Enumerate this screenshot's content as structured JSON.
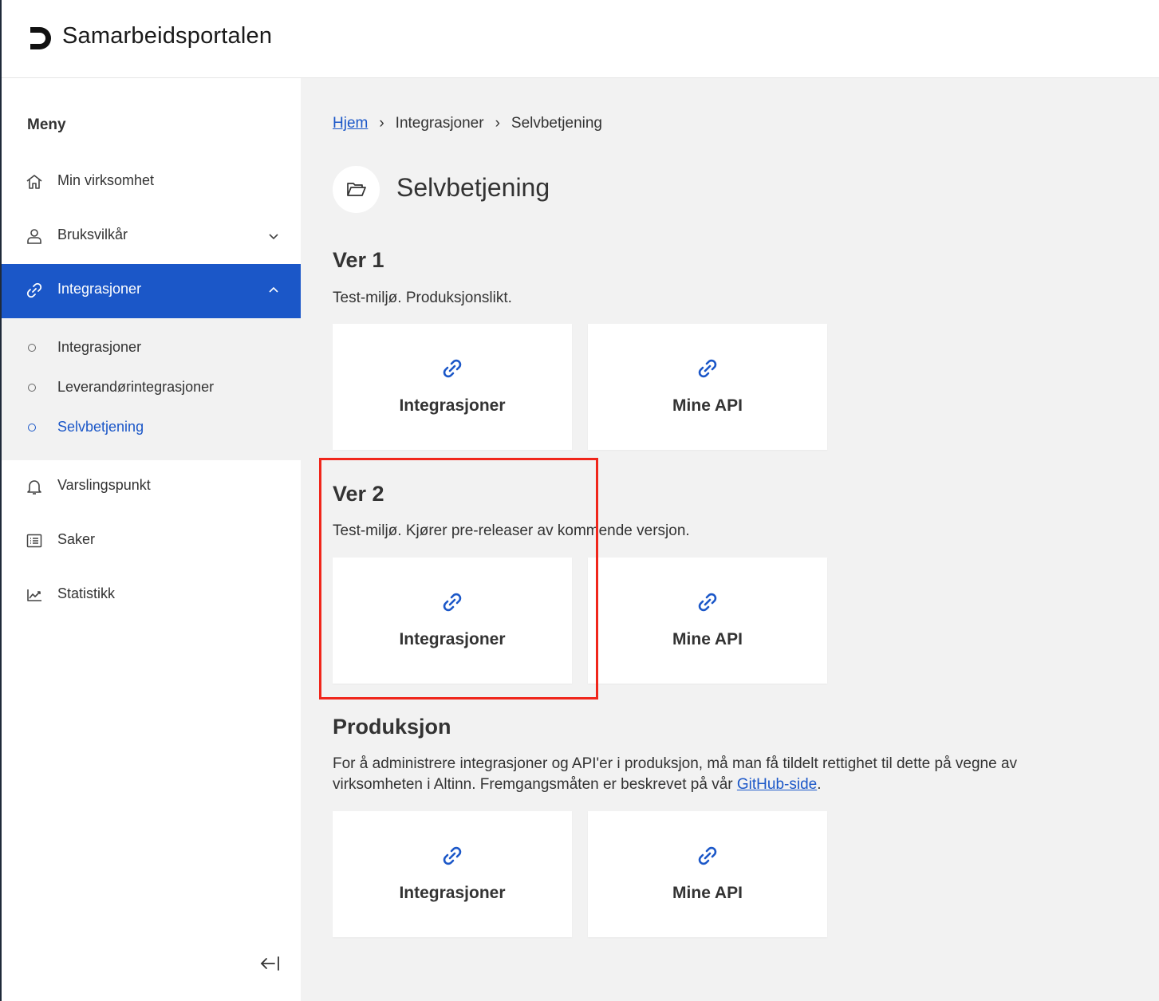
{
  "header": {
    "app_title": "Samarbeidsportalen"
  },
  "sidebar": {
    "menu_title": "Meny",
    "items": [
      {
        "label": "Min virksomhet",
        "icon": "home-icon"
      },
      {
        "label": "Bruksvilkår",
        "icon": "user-icon"
      },
      {
        "label": "Integrasjoner",
        "icon": "link-icon",
        "active": true
      },
      {
        "label": "Varslingspunkt",
        "icon": "bell-icon"
      },
      {
        "label": "Saker",
        "icon": "list-icon"
      },
      {
        "label": "Statistikk",
        "icon": "chart-icon"
      }
    ],
    "subitems": [
      {
        "label": "Integrasjoner"
      },
      {
        "label": "Leverandørintegrasjoner"
      },
      {
        "label": "Selvbetjening",
        "current": true
      }
    ]
  },
  "breadcrumb": {
    "home": "Hjem",
    "level1": "Integrasjoner",
    "current": "Selvbetjening",
    "separator": "›"
  },
  "page": {
    "title": "Selvbetjening",
    "icon": "folder-open-icon"
  },
  "sections": [
    {
      "title": "Ver 1",
      "description": "Test-miljø. Produksjonslikt.",
      "cards": [
        {
          "label": "Integrasjoner"
        },
        {
          "label": "Mine API"
        }
      ]
    },
    {
      "title": "Ver 2",
      "description": "Test-miljø. Kjører pre-releaser av kommende versjon.",
      "cards": [
        {
          "label": "Integrasjoner"
        },
        {
          "label": "Mine API"
        }
      ]
    },
    {
      "title": "Produksjon",
      "description_line1": "For å administrere integrasjoner og API'er i produksjon, må man få tildelt rettighet til dette på vegne av",
      "description_line2": "virksomheten i Altinn. Fremgangsmåten er beskrevet på vår ",
      "link": "GitHub-side",
      "description_end": ".",
      "cards": [
        {
          "label": "Integrasjoner"
        },
        {
          "label": "Mine API"
        }
      ]
    }
  ],
  "colors": {
    "accent": "#1b57c8",
    "highlight": "#f0261b",
    "background": "#f2f2f2"
  }
}
